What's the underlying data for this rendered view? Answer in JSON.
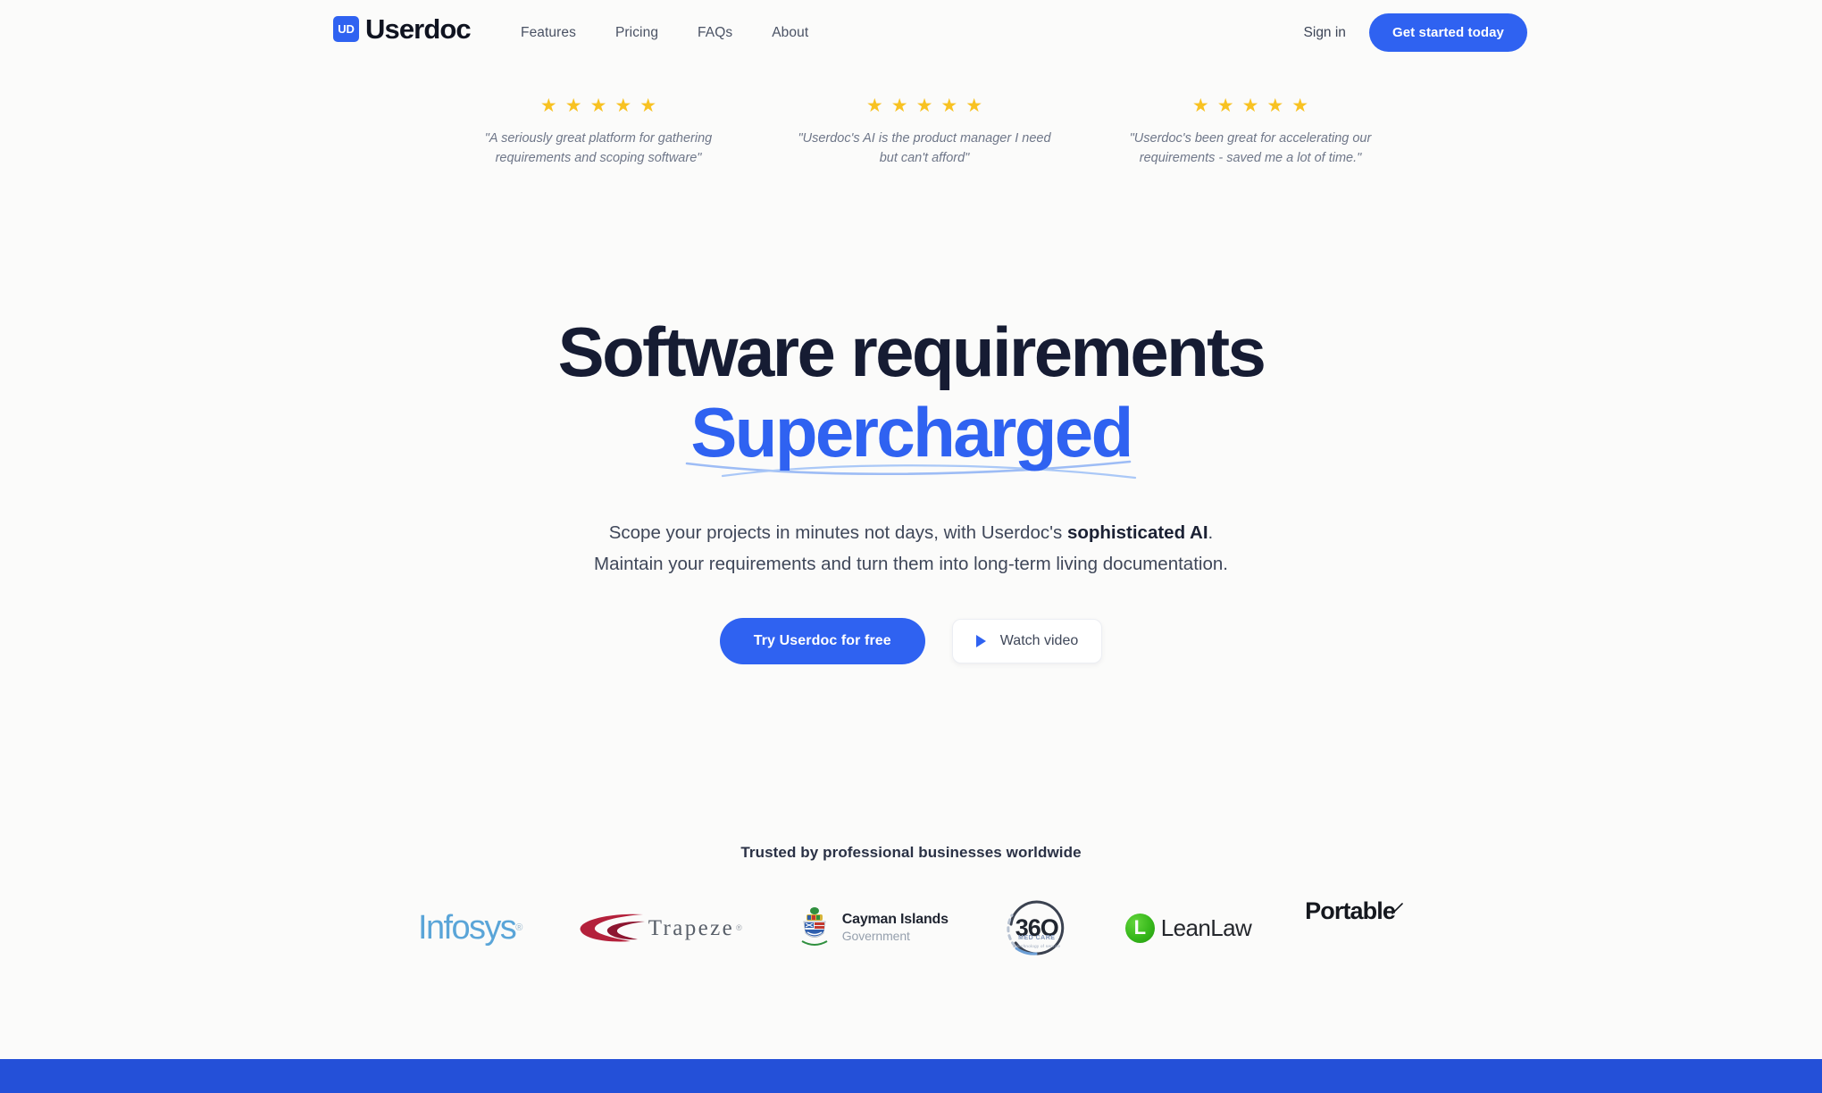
{
  "brand": {
    "mark_text": "UD",
    "name": "Userdoc"
  },
  "nav": {
    "items": [
      {
        "label": "Features"
      },
      {
        "label": "Pricing"
      },
      {
        "label": "FAQs"
      },
      {
        "label": "About"
      }
    ],
    "signin_label": "Sign in",
    "cta_label": "Get started today"
  },
  "testimonials": [
    {
      "stars": 5,
      "star_glyph": "★",
      "quote": "\"A seriously great platform for gathering requirements and scoping software\""
    },
    {
      "stars": 5,
      "star_glyph": "★",
      "quote": "\"Userdoc's AI is the product manager I need but can't afford\""
    },
    {
      "stars": 5,
      "star_glyph": "★",
      "quote": "\"Userdoc's been great for accelerating our requirements - saved me a lot of time.\""
    }
  ],
  "hero": {
    "title_line1": "Software requirements",
    "title_line2": "Supercharged",
    "sub_line1_a": "Scope your projects in minutes not days, with Userdoc's ",
    "sub_line1_bold": "sophisticated AI",
    "sub_line1_b": ".",
    "sub_line2": "Maintain your requirements and turn them into long-term living documentation.",
    "cta_primary": "Try Userdoc for free",
    "cta_secondary": "Watch video"
  },
  "trusted": {
    "title": "Trusted by professional businesses worldwide",
    "logos": [
      {
        "name": "Infosys",
        "text": "Infosys",
        "reg": "®"
      },
      {
        "name": "Trapeze",
        "text": "Trapeze",
        "reg": "®"
      },
      {
        "name": "Cayman Islands Government",
        "text_line1": "Cayman Islands",
        "text_line2": "Government"
      },
      {
        "name": "360 Med Care",
        "text": "36O",
        "sub1": "MED CARE",
        "sub2": "a technology of service"
      },
      {
        "name": "LeanLaw",
        "mark": "L",
        "text": "LeanLaw"
      },
      {
        "name": "Portable",
        "text": "Portable"
      }
    ]
  },
  "colors": {
    "brand_blue": "#2f62f1",
    "footer_blue": "#2450d8",
    "star_yellow": "#f8c222",
    "headline_navy": "#161c33",
    "page_bg": "#fbfbfa"
  }
}
